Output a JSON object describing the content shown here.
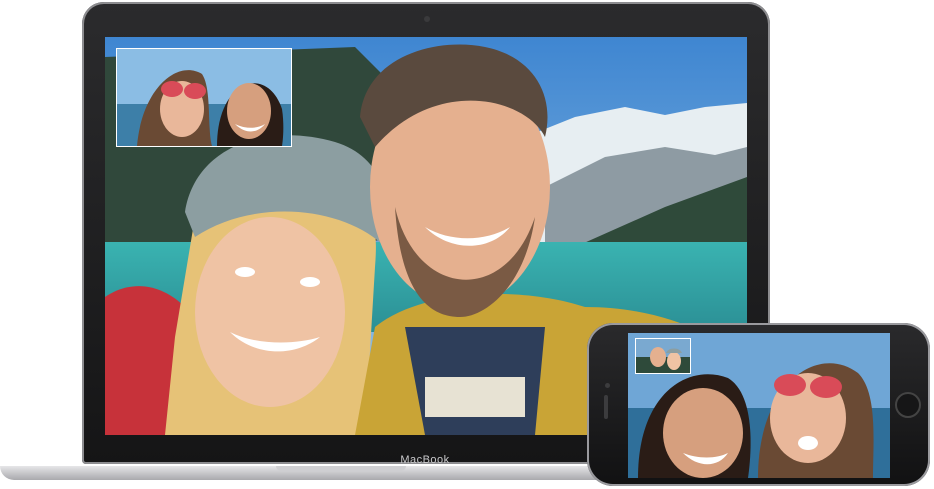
{
  "macbook": {
    "brand_label": "MacBook"
  },
  "colors": {
    "sky": "#6fa0c8",
    "lake": "#3aa7a6",
    "forest": "#2f4a3a",
    "snow": "#e8ecef",
    "jacket": "#c9a436",
    "sweater_red": "#c7323a"
  },
  "icons": {
    "mac_camera": "camera-dot-icon",
    "phone_home": "home-button-icon"
  }
}
